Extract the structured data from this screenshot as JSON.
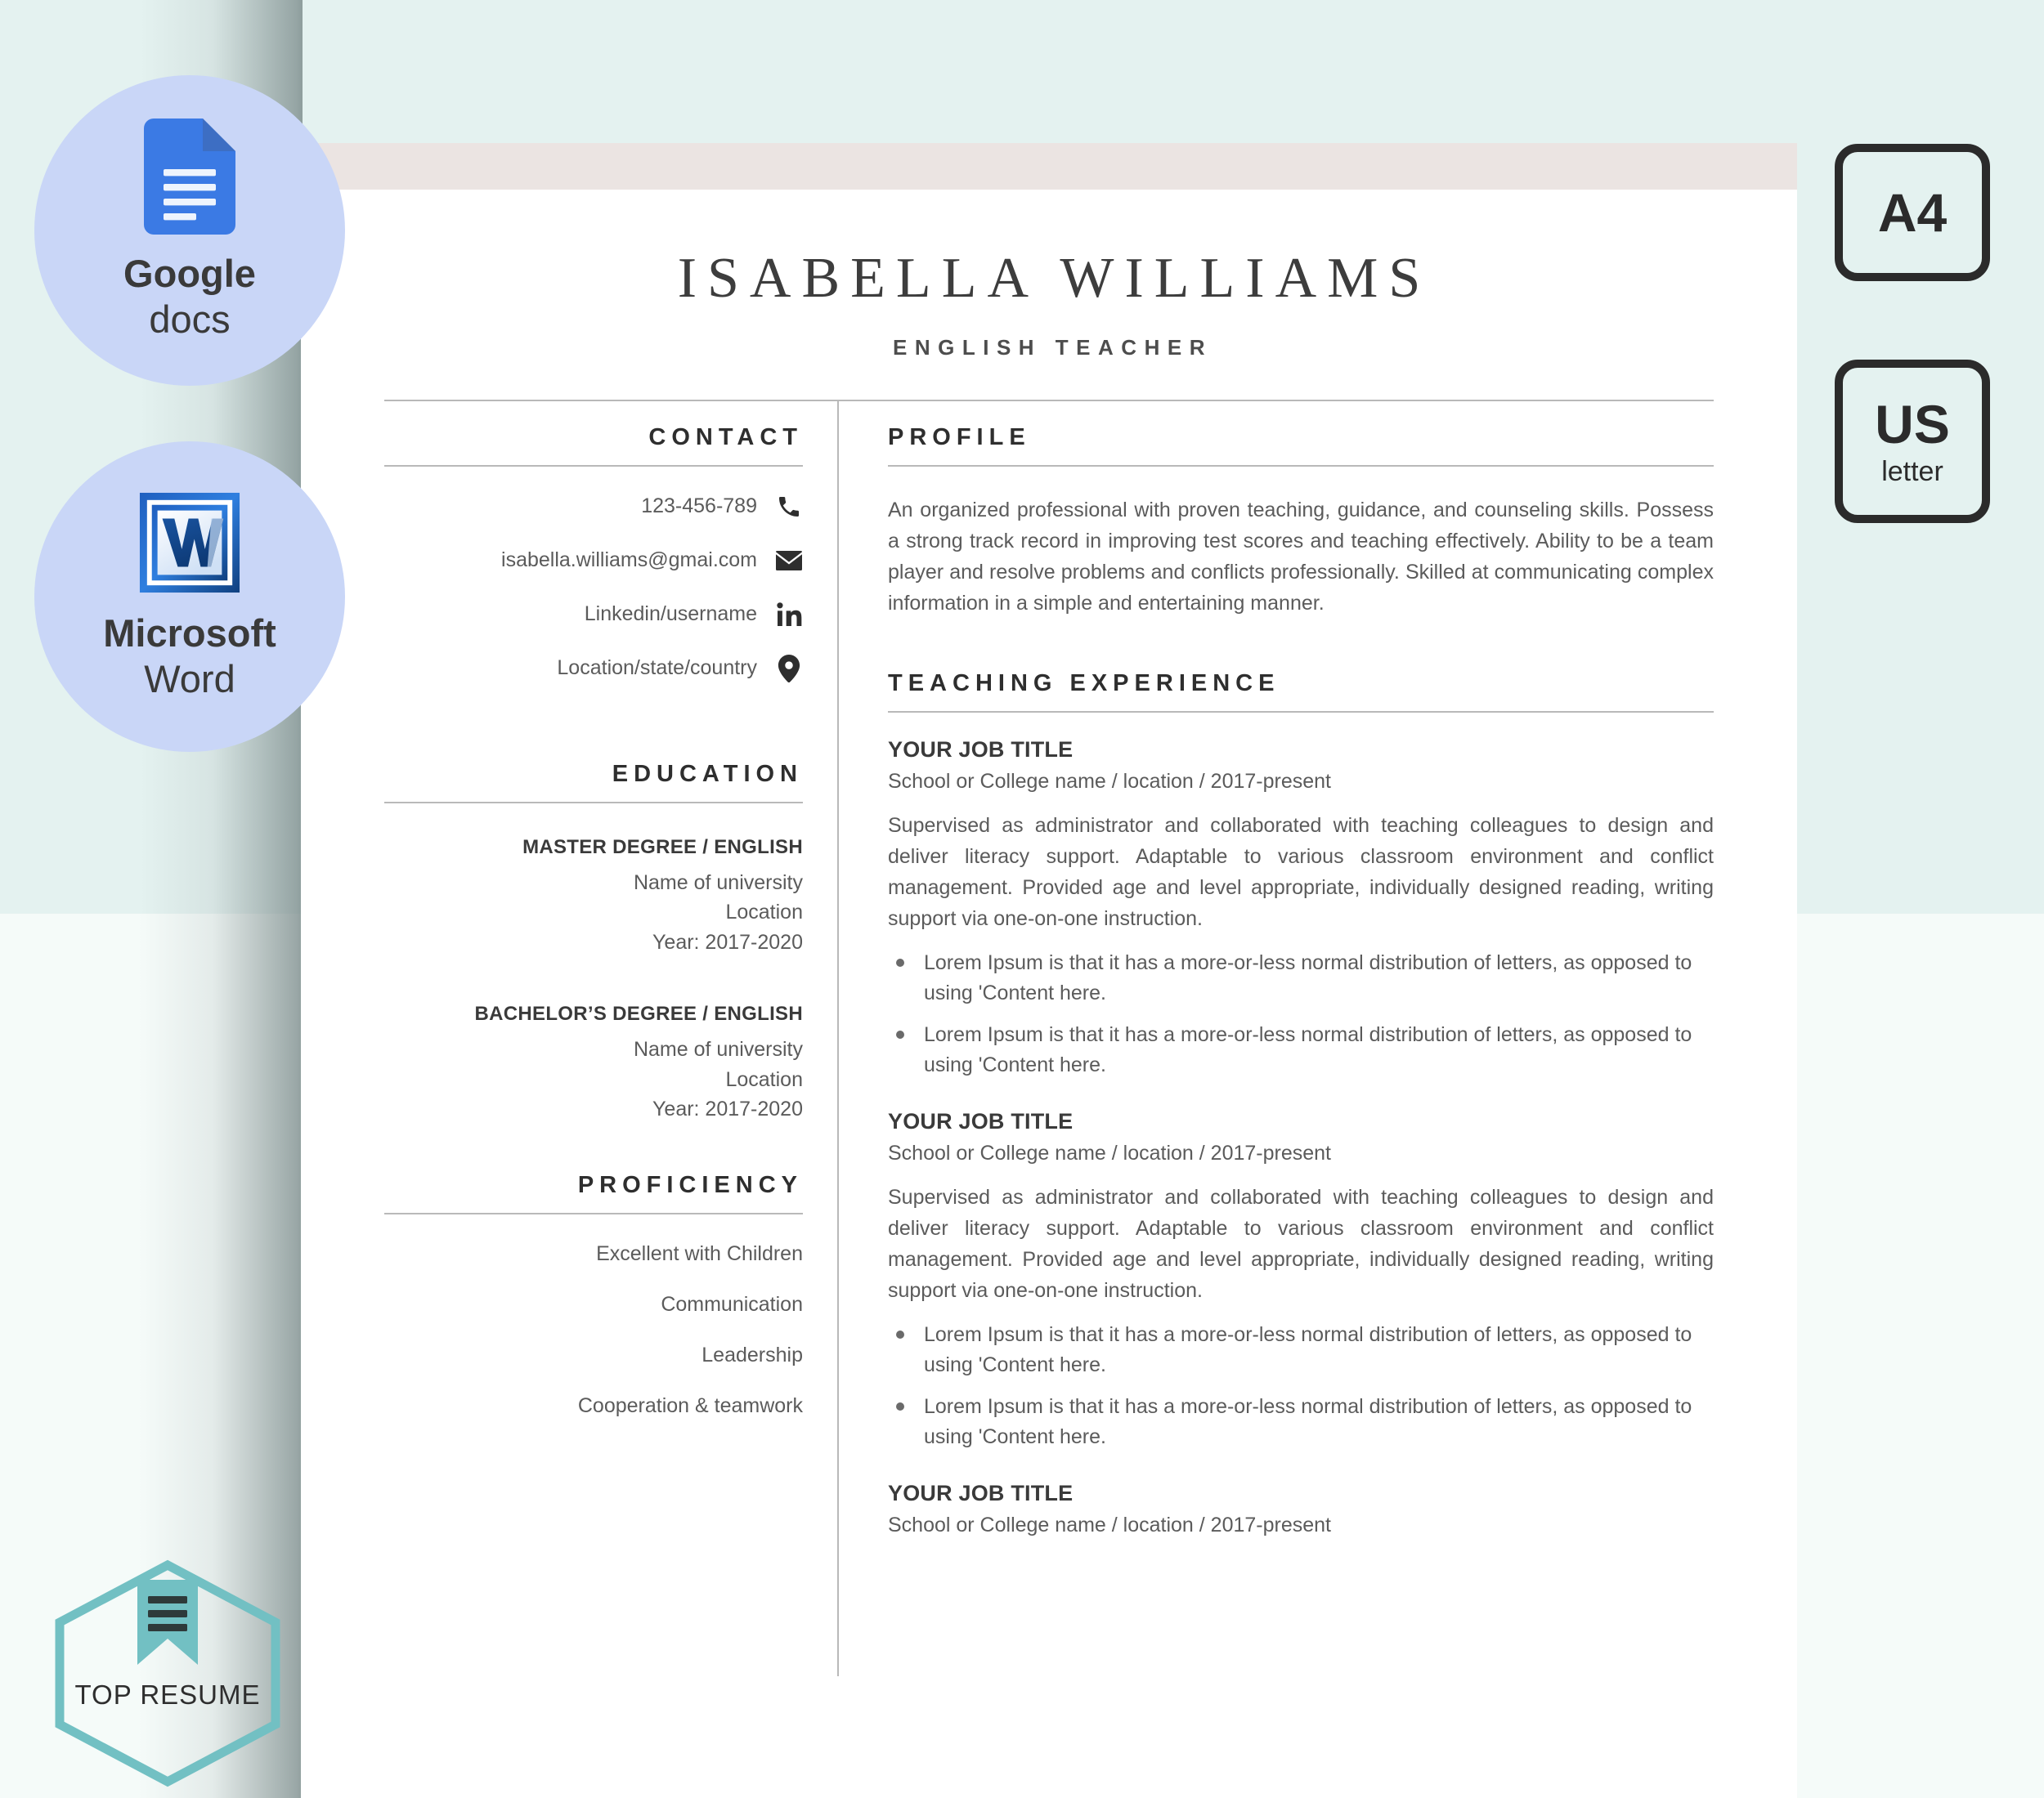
{
  "promo": {
    "badges": [
      {
        "icon": "google-docs-icon",
        "main": "Google",
        "sub": "docs"
      },
      {
        "icon": "microsoft-word-icon",
        "main": "Microsoft",
        "sub": "Word"
      }
    ],
    "formats": [
      {
        "main": "A4",
        "sub": ""
      },
      {
        "main": "US",
        "sub": "letter"
      }
    ],
    "logo": {
      "text": "TOP RESUME",
      "icon": "bookmark-ribbon-icon",
      "color": "#72c0c3"
    }
  },
  "resume": {
    "name": "ISABELLA WILLIAMS",
    "job_title": "ENGLISH TEACHER",
    "contact": {
      "heading": "CONTACT",
      "items": [
        {
          "icon": "phone-icon",
          "text": "123-456-789"
        },
        {
          "icon": "envelope-icon",
          "text": "isabella.williams@gmai.com"
        },
        {
          "icon": "linkedin-icon",
          "text": "Linkedin/username"
        },
        {
          "icon": "location-pin-icon",
          "text": "Location/state/country"
        }
      ]
    },
    "education": {
      "heading": "EDUCATION",
      "items": [
        {
          "degree": "MASTER DEGREE / ENGLISH",
          "university": "Name of university",
          "location": "Location",
          "year": "Year: 2017-2020"
        },
        {
          "degree": "BACHELOR’S DEGREE / ENGLISH",
          "university": "Name of university",
          "location": "Location",
          "year": "Year: 2017-2020"
        }
      ]
    },
    "proficiency": {
      "heading": "PROFICIENCY",
      "items": [
        "Excellent with Children",
        "Communication",
        "Leadership",
        "Cooperation & teamwork"
      ]
    },
    "profile": {
      "heading": "PROFILE",
      "text": "An organized professional with proven teaching, guidance, and counseling skills. Possess a strong track record in improving test scores and teaching effectively. Ability to be a team player and resolve problems and conflicts professionally. Skilled at communicating complex information in a simple and entertaining manner."
    },
    "experience": {
      "heading": "TEACHING EXPERIENCE",
      "items": [
        {
          "title": "YOUR JOB TITLE",
          "meta": "School or College name / location / 2017-present",
          "description": "Supervised as administrator and collaborated with teaching colleagues to design and deliver literacy support. Adaptable to various classroom environment and conflict management. Provided age and level appropriate, individually designed reading, writing support via one-on-one instruction.",
          "bullets": [
            "Lorem Ipsum is that it has a more-or-less normal distribution of letters, as opposed to using 'Content here.",
            "Lorem Ipsum is that it has a more-or-less normal distribution of letters, as opposed to using 'Content here."
          ]
        },
        {
          "title": "YOUR JOB TITLE",
          "meta": "School or College name / location / 2017-present",
          "description": "Supervised as administrator and collaborated with teaching colleagues to design and deliver literacy support. Adaptable to various classroom environment and conflict management. Provided age and level appropriate, individually designed reading, writing support via one-on-one instruction.",
          "bullets": [
            "Lorem Ipsum is that it has a more-or-less normal distribution of letters, as opposed to using 'Content here.",
            "Lorem Ipsum is that it has a more-or-less normal distribution of letters, as opposed to using 'Content here."
          ]
        },
        {
          "title": "YOUR JOB TITLE",
          "meta": "School or College name / location / 2017-present",
          "description": "",
          "bullets": []
        }
      ]
    }
  },
  "colors": {
    "background_top": "#e4f2f0",
    "background_bottom": "#f5fbf9",
    "paper": "#ffffff",
    "page_band": "#ebe4e2",
    "rule": "#b9b9b9",
    "badge_circle": "#c9d6f7",
    "teal": "#72c0c3",
    "text_dark": "#2e2e2e",
    "text_body": "#5b5b5b"
  }
}
